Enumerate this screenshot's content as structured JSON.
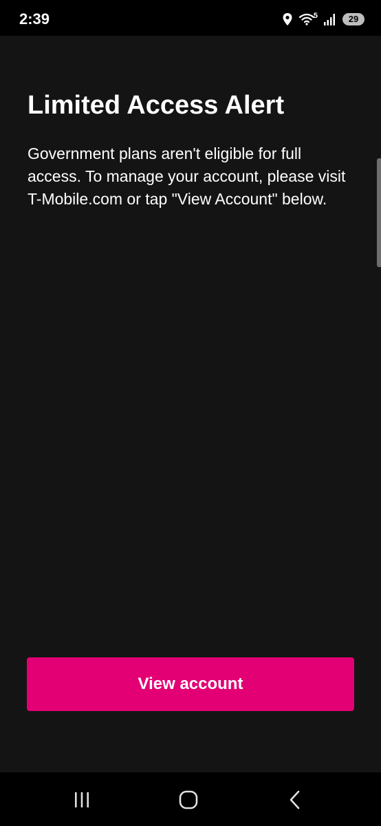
{
  "status_bar": {
    "time": "2:39",
    "network_badge": "5",
    "battery_level": "29",
    "icons": [
      "location-icon",
      "wifi-icon",
      "signal-icon",
      "battery-icon"
    ]
  },
  "alert": {
    "title": "Limited Access Alert",
    "body": "Government plans aren't eligible for full access. To manage your account, please visit T-Mobile.com or tap \"View Account\" below."
  },
  "actions": {
    "view_account_label": "View account"
  },
  "nav_bar": {
    "icons": [
      "recent-apps-icon",
      "home-icon",
      "back-icon"
    ]
  },
  "colors": {
    "background": "#141414",
    "bars": "#000000",
    "accent": "#e20074",
    "text": "#ffffff"
  }
}
